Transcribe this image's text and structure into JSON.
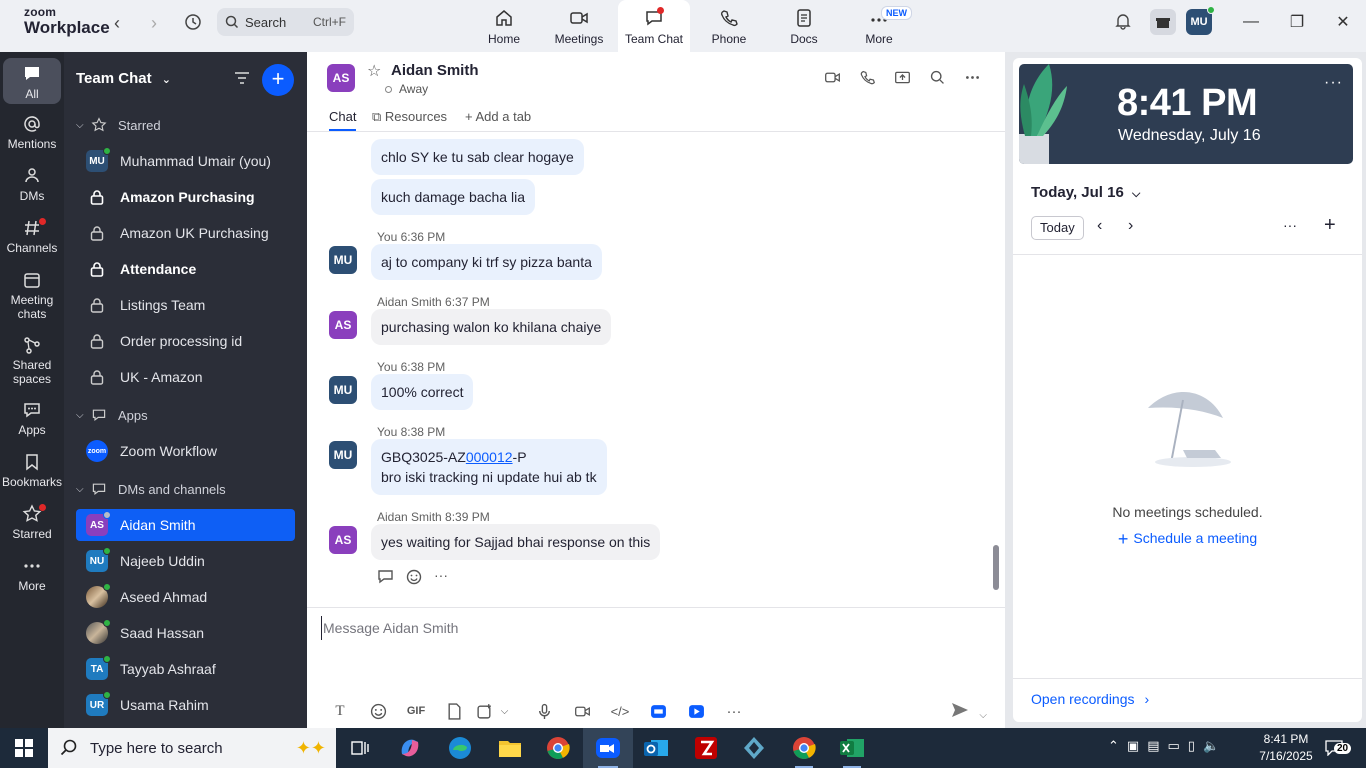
{
  "app": {
    "logo_line1": "zoom",
    "logo_line2": "Workplace",
    "search_label": "Search",
    "search_shortcut": "Ctrl+F"
  },
  "top_tabs": [
    {
      "label": "Home",
      "icon": "home-icon"
    },
    {
      "label": "Meetings",
      "icon": "video-icon"
    },
    {
      "label": "Team Chat",
      "icon": "chat-icon",
      "active": true
    },
    {
      "label": "Phone",
      "icon": "phone-icon"
    },
    {
      "label": "Docs",
      "icon": "docs-icon"
    },
    {
      "label": "More",
      "icon": "more-icon",
      "badge": "NEW"
    }
  ],
  "user": {
    "initials": "MU"
  },
  "rail": [
    {
      "label": "All",
      "icon": "chat-bubble-icon",
      "active": true
    },
    {
      "label": "Mentions",
      "icon": "at-icon"
    },
    {
      "label": "DMs",
      "icon": "people-icon"
    },
    {
      "label": "Channels",
      "icon": "hash-icon",
      "dot": true
    },
    {
      "label_1": "Meeting",
      "label_2": "chats",
      "icon": "calendar-icon"
    },
    {
      "label_1": "Shared",
      "label_2": "spaces",
      "icon": "shared-spaces-icon"
    },
    {
      "label": "Apps",
      "icon": "apps-icon"
    },
    {
      "label": "Bookmarks",
      "icon": "bookmark-icon"
    },
    {
      "label": "Starred",
      "icon": "star-icon",
      "dot": true
    },
    {
      "label": "More",
      "icon": "more-dots-icon"
    }
  ],
  "sidebar": {
    "title": "Team Chat",
    "starred_label": "Starred",
    "starred": [
      {
        "name": "Muhammad Umair (you)",
        "initials": "MU",
        "color": "#2d4f74",
        "online": true
      },
      {
        "name": "Amazon Purchasing",
        "locked": true,
        "bold": true
      },
      {
        "name": "Amazon UK Purchasing",
        "locked": true
      },
      {
        "name": "Attendance",
        "locked": true,
        "bold": true
      },
      {
        "name": "Listings Team",
        "locked": true
      },
      {
        "name": "Order processing id",
        "locked": true
      },
      {
        "name": "UK - Amazon",
        "locked": true
      }
    ],
    "apps_label": "Apps",
    "apps": [
      {
        "name": "Zoom Workflow",
        "icon_text": "zoom"
      }
    ],
    "dms_label": "DMs and channels",
    "dms": [
      {
        "name": "Aidan Smith",
        "initials": "AS",
        "color": "#8a3fbd",
        "selected": true
      },
      {
        "name": "Najeeb Uddin",
        "initials": "NU",
        "color": "#1f7bbf",
        "online": true
      },
      {
        "name": "Aseed Ahmad",
        "photo": true,
        "online": true
      },
      {
        "name": "Saad Hassan",
        "photo": true,
        "online": true
      },
      {
        "name": "Tayyab Ashraaf",
        "initials": "TA",
        "color": "#1f7bbf",
        "online": true
      },
      {
        "name": "Usama Rahim",
        "initials": "UR",
        "color": "#1f7bbf",
        "online": true
      }
    ]
  },
  "chat": {
    "contact_name": "Aidan Smith",
    "contact_initials": "AS",
    "status": "Away",
    "tabs": {
      "chat": "Chat",
      "resources": "Resources",
      "add_tab": "Add a tab"
    },
    "messages": [
      {
        "text": "chlo SY ke tu sab clear hogaye"
      },
      {
        "text": "kuch damage bacha lia"
      },
      {
        "sender": "You",
        "time": "6:36 PM",
        "avatar": "MU",
        "text": "aj to company ki trf sy pizza banta"
      },
      {
        "sender": "Aidan Smith",
        "time": "6:37 PM",
        "avatar": "AS",
        "text": "purchasing walon ko khilana chaiye"
      },
      {
        "sender": "You",
        "time": "6:38 PM",
        "avatar": "MU",
        "text": "100% correct"
      },
      {
        "sender": "You",
        "time": "8:38 PM",
        "avatar": "MU",
        "text_prefix": "GBQ3025-AZ",
        "text_link": "000012",
        "text_suffix": "-P",
        "text_line2": "bro iski tracking ni update hui ab tk"
      },
      {
        "sender": "Aidan Smith",
        "time": "8:39 PM",
        "avatar": "AS",
        "text": "yes waiting for Sajjad bhai response on this"
      }
    ],
    "compose_placeholder": "Message Aidan Smith",
    "toolbar_gif": "GIF"
  },
  "calendar": {
    "time": "8:41 PM",
    "date": "Wednesday, July 16",
    "today_header": "Today, Jul 16",
    "today_button": "Today",
    "empty_text": "No meetings scheduled.",
    "schedule_link": "Schedule a meeting",
    "open_recordings": "Open recordings"
  },
  "taskbar": {
    "search_placeholder": "Type here to search",
    "clock_time": "8:41 PM",
    "clock_date": "7/16/2025",
    "notifications": "20"
  },
  "colors": {
    "accent": "#0b5cff",
    "bubble": "#e9f1fd",
    "sidebar": "#2b2e38",
    "rail": "#24272f"
  }
}
